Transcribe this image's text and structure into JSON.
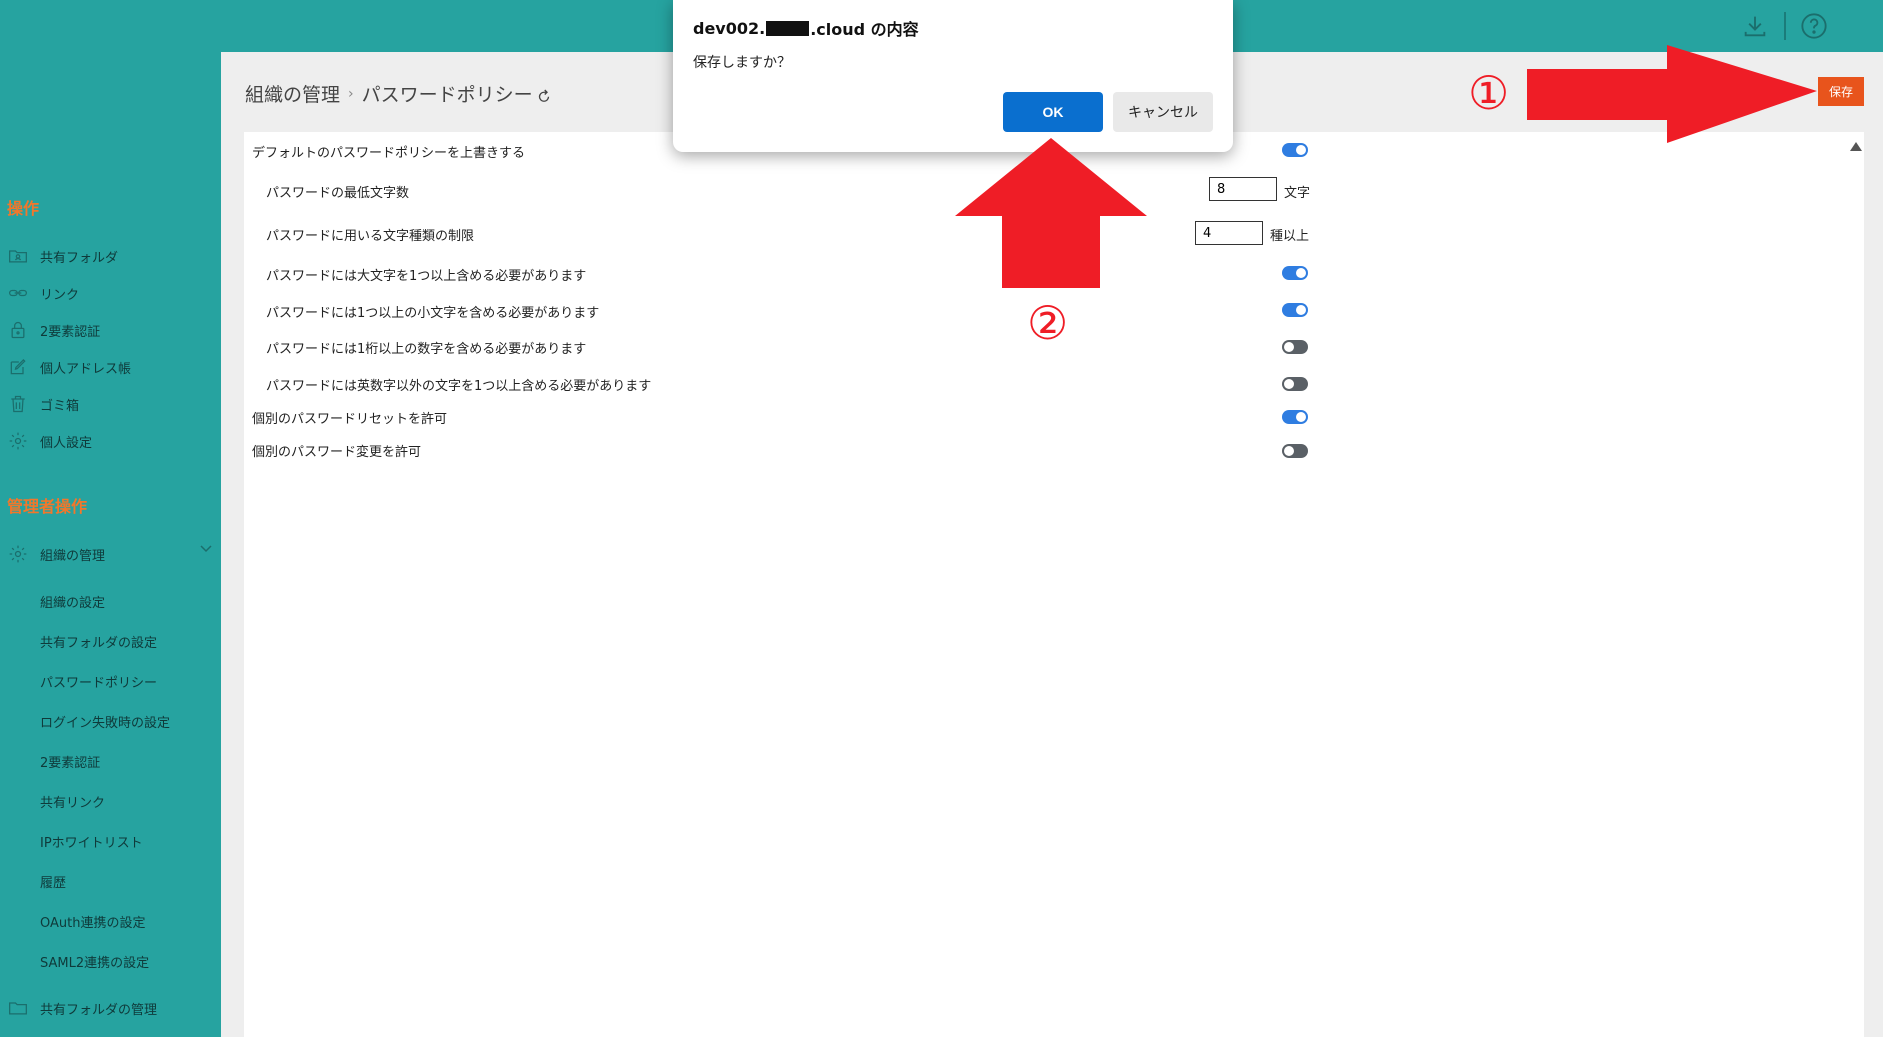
{
  "dialog": {
    "title_prefix": "dev002.",
    "title_suffix": ".cloud の内容",
    "message": "保存しますか？",
    "ok_label": "OK",
    "cancel_label": "キャンセル"
  },
  "breadcrumb": {
    "parent": "組織の管理",
    "separator": "›",
    "current": "パスワードポリシー"
  },
  "save_label": "保存",
  "sidebar": {
    "section_operations": "操作",
    "operations": [
      {
        "label": "共有フォルダ",
        "icon": "folder-user-icon"
      },
      {
        "label": "リンク",
        "icon": "link-icon"
      },
      {
        "label": "2要素認証",
        "icon": "lock-icon"
      },
      {
        "label": "個人アドレス帳",
        "icon": "edit-icon"
      },
      {
        "label": "ゴミ箱",
        "icon": "trash-icon"
      },
      {
        "label": "個人設定",
        "icon": "gear-icon"
      }
    ],
    "section_admin": "管理者操作",
    "org_management": {
      "label": "組織の管理",
      "icon": "gear-icon"
    },
    "org_sub_items": [
      "組織の設定",
      "共有フォルダの設定",
      "パスワードポリシー",
      "ログイン失敗時の設定",
      "2要素認証",
      "共有リンク",
      "IPホワイトリスト",
      "履歴",
      "OAuth連携の設定",
      "SAML2連携の設定"
    ],
    "shared_folder_management": {
      "label": "共有フォルダの管理",
      "icon": "folder-icon"
    }
  },
  "policy": {
    "override_default": {
      "label": "デフォルトのパスワードポリシーを上書きする",
      "enabled": true
    },
    "min_length": {
      "label": "パスワードの最低文字数",
      "value": "8",
      "unit": "文字"
    },
    "char_types": {
      "label": "パスワードに用いる文字種類の制限",
      "value": "4",
      "unit": "種以上"
    },
    "require_upper": {
      "label": "パスワードには大文字を1つ以上含める必要があります",
      "enabled": true
    },
    "require_lower": {
      "label": "パスワードには1つ以上の小文字を含める必要があります",
      "enabled": true
    },
    "require_digit": {
      "label": "パスワードには1桁以上の数字を含める必要があります",
      "enabled": false
    },
    "require_symbol": {
      "label": "パスワードには英数字以外の文字を1つ以上含める必要があります",
      "enabled": false
    },
    "allow_individual_reset": {
      "label": "個別のパスワードリセットを許可",
      "enabled": true
    },
    "allow_individual_change": {
      "label": "個別のパスワード変更を許可",
      "enabled": false
    }
  },
  "annotations": {
    "step1": "①",
    "step2": "②",
    "arrow_color": "#ef1d26"
  },
  "colors": {
    "sidebar_bg": "#26a3a0",
    "accent_orange": "#f2772b",
    "save_button": "#e8541c",
    "ok_button": "#0a6fcf",
    "toggle_on": "#2f7de1"
  }
}
